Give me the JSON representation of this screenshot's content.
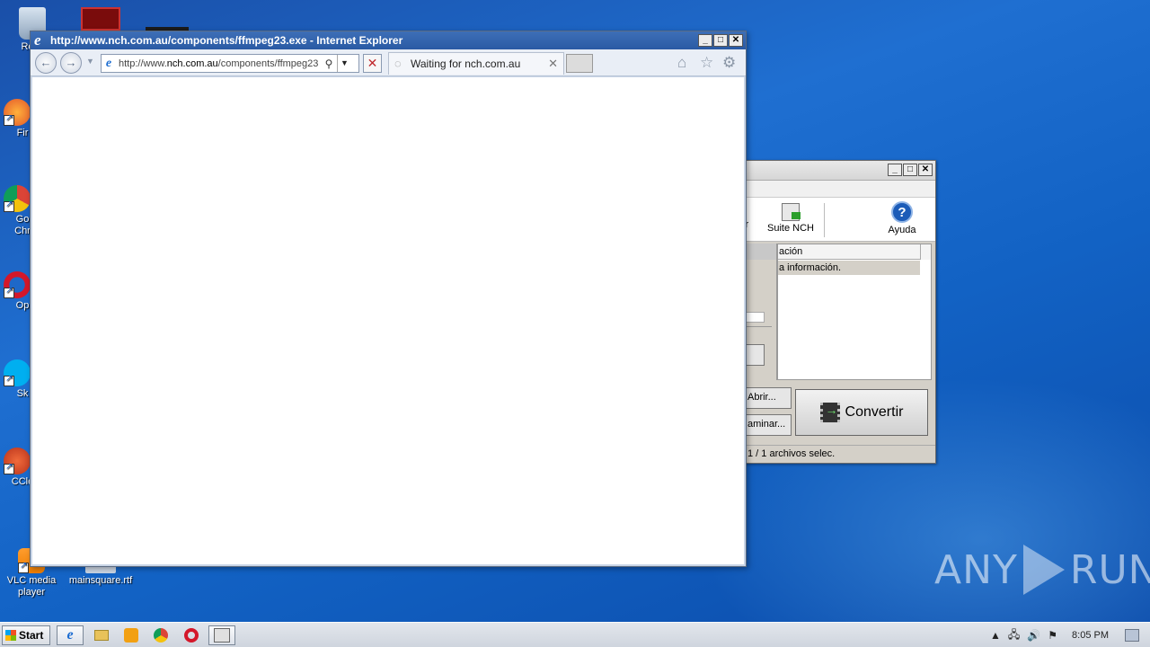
{
  "desktop": {
    "icons": [
      {
        "label": "Recy",
        "icon": "recycle-bin-icon"
      },
      {
        "label": "Fir",
        "icon": "firefox-icon"
      },
      {
        "label": "Go\nChr",
        "icon": "chrome-icon"
      },
      {
        "label": "Op",
        "icon": "opera-icon"
      },
      {
        "label": "Sk",
        "icon": "skype-icon"
      },
      {
        "label": "CCle",
        "icon": "ccleaner-icon"
      },
      {
        "label": "VLC media player",
        "icon": "vlc-icon"
      },
      {
        "label": "mainsquare.rtf",
        "icon": "rtf-document-icon"
      }
    ]
  },
  "ie": {
    "title": "http://www.nch.com.au/components/ffmpeg23.exe - Internet Explorer",
    "address_prefix": "http://www.",
    "address_domain": "nch.com.au",
    "address_rest": "/components/ffmpeg23",
    "tab_label": "Waiting for nch.com.au"
  },
  "nch": {
    "toolbar_partial": "ir",
    "suite_label": "Suite NCH",
    "help_label": "Ayuda",
    "list_header": "ación",
    "list_row": "a información.",
    "open_button": "Abrir...",
    "remove_button": "aminar...",
    "convert_button": "Convertir",
    "status": "1 / 1 archivos selec."
  },
  "taskbar": {
    "start_label": "Start",
    "clock": "8:05 PM"
  },
  "watermark": {
    "left": "ANY",
    "right": "RUN"
  },
  "colors": {
    "desktop": "#1f6fd1",
    "ie_title": "#2a5aa4",
    "stop_red": "#c0282c"
  }
}
